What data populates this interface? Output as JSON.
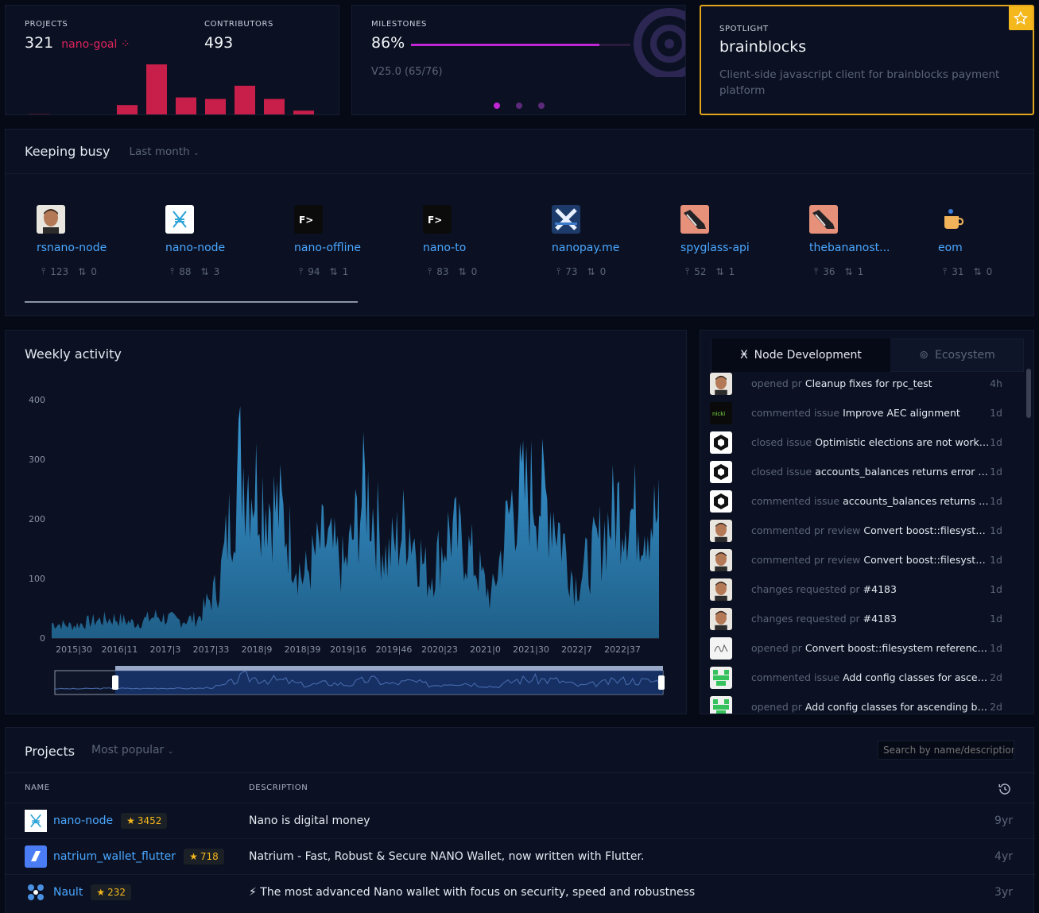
{
  "projects_card": {
    "label": "PROJECTS",
    "count": "321",
    "goal": "nano-goal",
    "bars": [
      0.02,
      0.0,
      0.0,
      0.2,
      1.0,
      0.35,
      0.32,
      0.58,
      0.32,
      0.09
    ]
  },
  "contributors_card": {
    "label": "CONTRIBUTORS",
    "count": "493"
  },
  "milestones_card": {
    "label": "MILESTONES",
    "percent": "86%",
    "progress": 0.86,
    "version": "V25.0 (65/76)"
  },
  "spotlight": {
    "label": "SPOTLIGHT",
    "title": "brainblocks",
    "description": "Client-side javascript client for brainblocks payment platform"
  },
  "keeping_busy": {
    "title": "Keeping busy",
    "filter": "Last month",
    "items": [
      {
        "name": "rsnano-node",
        "commits": "123",
        "prs": "0",
        "icon": "avatar-person"
      },
      {
        "name": "nano-node",
        "commits": "88",
        "prs": "3",
        "icon": "nano-logo"
      },
      {
        "name": "nano-offline",
        "commits": "94",
        "prs": "1",
        "icon": "fd-logo"
      },
      {
        "name": "nano-to",
        "commits": "83",
        "prs": "0",
        "icon": "fd-logo"
      },
      {
        "name": "nanopay.me",
        "commits": "73",
        "prs": "0",
        "icon": "x-logo"
      },
      {
        "name": "spyglass-api",
        "commits": "52",
        "prs": "1",
        "icon": "shoe-logo"
      },
      {
        "name": "thebananost...",
        "commits": "36",
        "prs": "1",
        "icon": "shoe-logo"
      },
      {
        "name": "eom",
        "commits": "31",
        "prs": "0",
        "icon": "cup-logo"
      }
    ]
  },
  "weekly": {
    "title": "Weekly activity"
  },
  "chart_data": {
    "type": "area",
    "title": "Weekly activity",
    "ylim": [
      0,
      400
    ],
    "yticks": [
      "400",
      "300",
      "200",
      "100",
      "0"
    ],
    "xticks": [
      "2015|30",
      "2016|11",
      "2017|3",
      "2017|33",
      "2018|9",
      "2018|39",
      "2019|16",
      "2019|46",
      "2020|23",
      "2021|0",
      "2021|30",
      "2022|7",
      "2022|37"
    ],
    "x": [
      "2015|30",
      "2015|45",
      "2016|11",
      "2016|28",
      "2017|3",
      "2017|20",
      "2017|33",
      "2017|45",
      "2018|1",
      "2018|5",
      "2018|9",
      "2018|15",
      "2018|22",
      "2018|30",
      "2018|39",
      "2019|3",
      "2019|16",
      "2019|30",
      "2019|46",
      "2020|8",
      "2020|23",
      "2020|38",
      "2021|0",
      "2021|15",
      "2021|30",
      "2021|45",
      "2022|7",
      "2022|20",
      "2022|37",
      "2022|45"
    ],
    "values": [
      30,
      25,
      35,
      40,
      30,
      45,
      35,
      40,
      110,
      360,
      300,
      250,
      120,
      200,
      140,
      310,
      160,
      240,
      120,
      220,
      170,
      80,
      280,
      300,
      260,
      110,
      180,
      270,
      250,
      240
    ],
    "series": [
      {
        "name": "",
        "color": "#2f86c0"
      }
    ]
  },
  "feed": {
    "tabs": [
      {
        "label": "Node Development",
        "icon": "nano-icon",
        "active": true
      },
      {
        "label": "Ecosystem",
        "icon": "hub-icon",
        "active": false
      }
    ],
    "rows": [
      {
        "action": "opened pr",
        "text": "Cleanup fixes for rpc_test",
        "time": "4h",
        "avatar": "person"
      },
      {
        "action": "commented issue",
        "text": "Improve AEC alignment",
        "time": "1d",
        "avatar": "nicki"
      },
      {
        "action": "closed issue",
        "text": "Optimistic elections are not worki...",
        "time": "1d",
        "avatar": "hex"
      },
      {
        "action": "closed issue",
        "text": "accounts_balances returns error o...",
        "time": "1d",
        "avatar": "hex"
      },
      {
        "action": "commented issue",
        "text": "accounts_balances returns e...",
        "time": "1d",
        "avatar": "hex"
      },
      {
        "action": "commented pr review",
        "text": "Convert boost::filesyste...",
        "time": "1d",
        "avatar": "person"
      },
      {
        "action": "commented pr review",
        "text": "Convert boost::filesyste...",
        "time": "1d",
        "avatar": "person"
      },
      {
        "action": "changes requested pr",
        "text": "#4183",
        "time": "1d",
        "avatar": "person"
      },
      {
        "action": "changes requested pr",
        "text": "#4183",
        "time": "1d",
        "avatar": "person"
      },
      {
        "action": "opened pr",
        "text": "Convert boost::filesystem reference...",
        "time": "1d",
        "avatar": "sig"
      },
      {
        "action": "commented issue",
        "text": "Add config classes for ascen...",
        "time": "2d",
        "avatar": "green"
      },
      {
        "action": "opened pr",
        "text": "Add config classes for ascending bo...",
        "time": "2d",
        "avatar": "green"
      }
    ]
  },
  "projects": {
    "title": "Projects",
    "filter": "Most popular",
    "search_placeholder": "Search by name/description",
    "col_name": "NAME",
    "col_desc": "DESCRIPTION",
    "rows": [
      {
        "name": "nano-node",
        "stars": "3452",
        "description": "Nano is digital money",
        "age": "9yr",
        "icon": "nano-logo"
      },
      {
        "name": "natrium_wallet_flutter",
        "stars": "718",
        "description": "Natrium - Fast, Robust & Secure NANO Wallet, now written with Flutter.",
        "age": "4yr",
        "icon": "natrium-logo"
      },
      {
        "name": "Nault",
        "stars": "232",
        "description": "⚡ The most advanced Nano wallet with focus on security, speed and robustness",
        "age": "3yr",
        "icon": "nault-logo"
      }
    ]
  }
}
